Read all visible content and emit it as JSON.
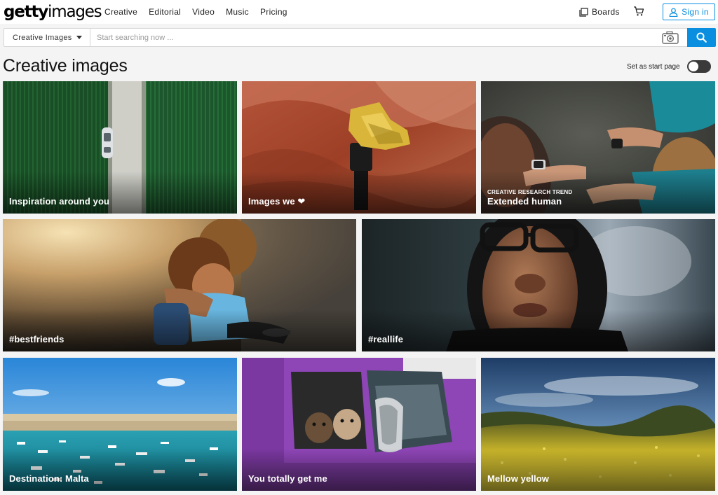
{
  "brand": {
    "logo_bold": "getty",
    "logo_light": "images"
  },
  "nav": {
    "items": [
      "Creative",
      "Editorial",
      "Video",
      "Music",
      "Pricing"
    ]
  },
  "header": {
    "boards_label": "Boards",
    "signin_label": "Sign in"
  },
  "search": {
    "type_label": "Creative Images",
    "placeholder": "Start searching now ..."
  },
  "page": {
    "title": "Creative images",
    "start_page_label": "Set as start page"
  },
  "colors": {
    "accent": "#0a8fe0"
  },
  "icons": {
    "boards": "boards-icon",
    "cart": "cart-icon",
    "user": "user-icon",
    "camera": "camera-icon",
    "search": "search-icon",
    "caret": "caret-down-icon"
  },
  "tiles": [
    {
      "caption": "Inspiration around you"
    },
    {
      "caption": "Images we ❤"
    },
    {
      "eyebrow": "CREATIVE RESEARCH TREND",
      "caption": "Extended human"
    },
    {
      "caption": "#bestfriends"
    },
    {
      "caption": "#reallife"
    },
    {
      "caption": "Destination: Malta"
    },
    {
      "caption": "You totally get me"
    },
    {
      "caption": "Mellow yellow"
    }
  ]
}
